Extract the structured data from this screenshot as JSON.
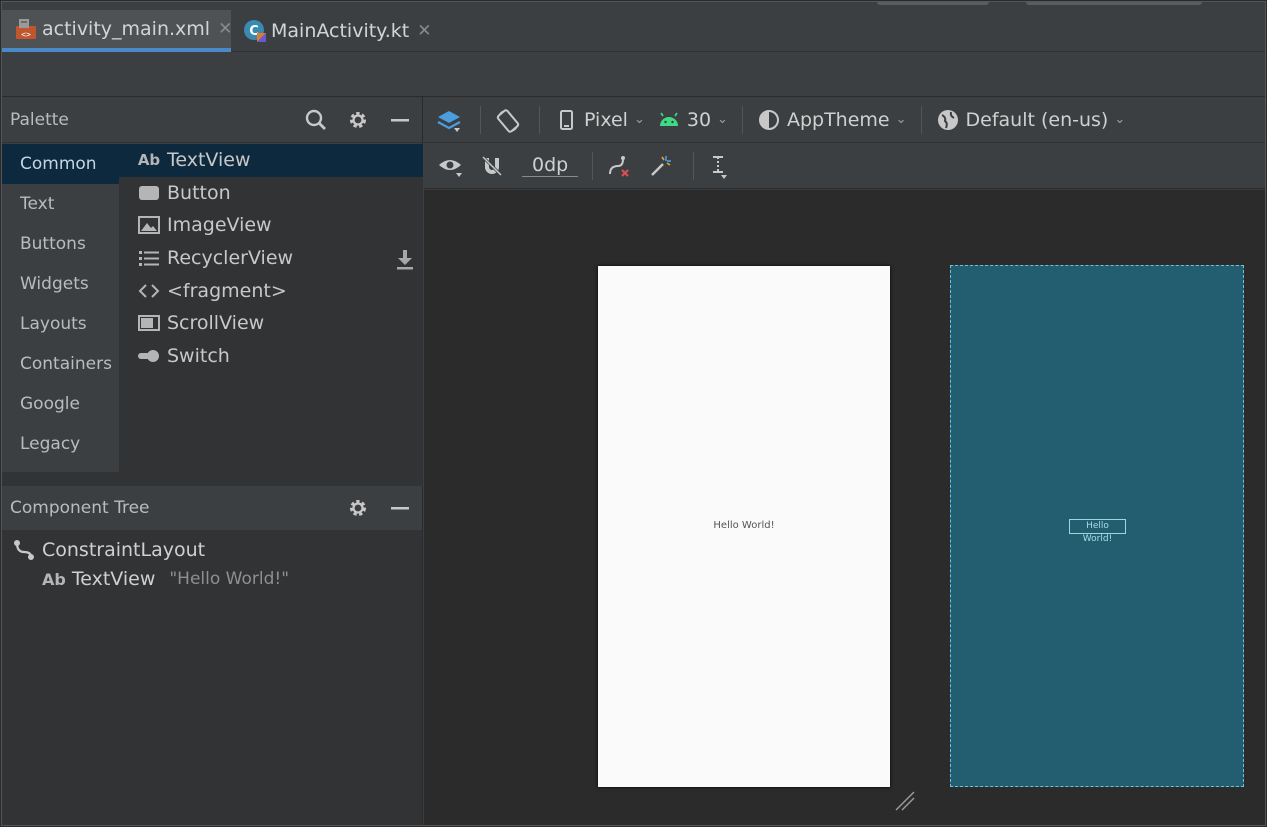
{
  "tabs": [
    {
      "label": "activity_main.xml",
      "icon": "xml-layout-icon",
      "active": true
    },
    {
      "label": "MainActivity.kt",
      "icon": "kotlin-class-icon",
      "active": false
    }
  ],
  "palette": {
    "title": "Palette",
    "categories": [
      "Common",
      "Text",
      "Buttons",
      "Widgets",
      "Layouts",
      "Containers",
      "Google",
      "Legacy"
    ],
    "selected_category": "Common",
    "items": [
      {
        "label": "TextView",
        "icon": "textview-icon",
        "icon_text": "Ab"
      },
      {
        "label": "Button",
        "icon": "button-icon"
      },
      {
        "label": "ImageView",
        "icon": "imageview-icon"
      },
      {
        "label": "RecyclerView",
        "icon": "list-icon"
      },
      {
        "label": "<fragment>",
        "icon": "code-brackets-icon"
      },
      {
        "label": "ScrollView",
        "icon": "scrollview-icon"
      },
      {
        "label": "Switch",
        "icon": "switch-icon"
      }
    ]
  },
  "component_tree": {
    "title": "Component Tree",
    "root": "ConstraintLayout",
    "child_icon_text": "Ab",
    "child": "TextView",
    "child_text": "\"Hello World!\""
  },
  "toolbar": {
    "device": "Pixel",
    "api": "30",
    "theme": "AppTheme",
    "locale": "Default (en-us)",
    "margin": "0dp"
  },
  "canvas": {
    "design_text": "Hello World!",
    "blueprint_text": "Hello World!",
    "blueprint_color": "#235e70",
    "accent": "#4a88c7"
  }
}
